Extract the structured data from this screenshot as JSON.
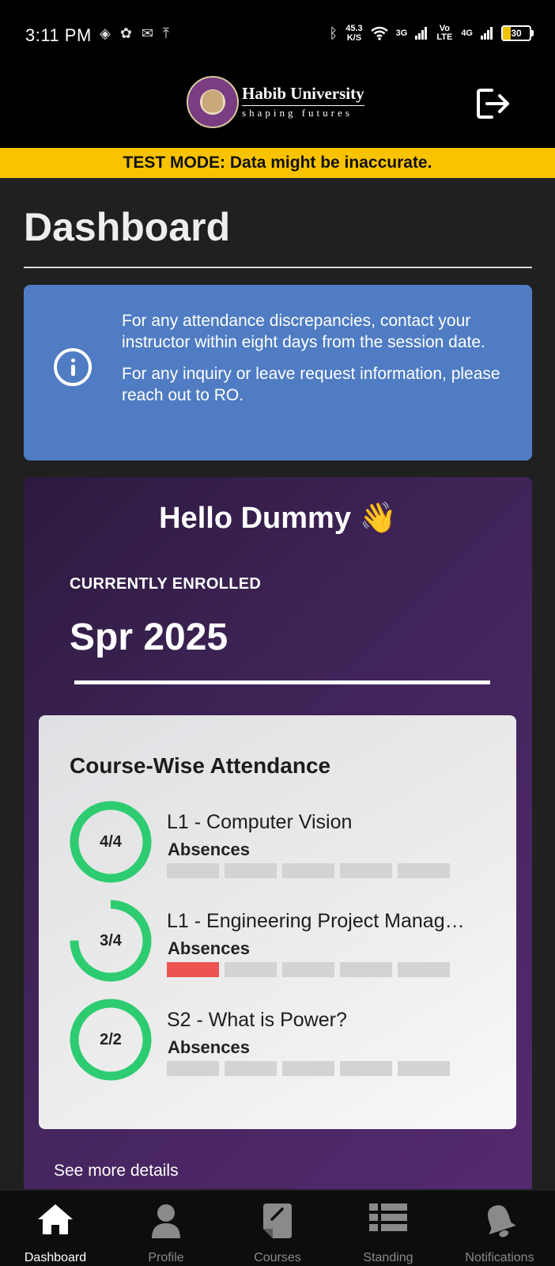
{
  "status_bar": {
    "time": "3:11 PM",
    "speed_value": "45.3",
    "speed_unit": "K/S",
    "net1": "3G",
    "volte": "Vo LTE",
    "net2": "4G",
    "battery": "30"
  },
  "header": {
    "university_name": "Habib University",
    "tagline": "shaping futures"
  },
  "banner": {
    "text": "TEST MODE: Data might be inaccurate."
  },
  "page": {
    "title": "Dashboard"
  },
  "info_card": {
    "line1": "For any attendance discrepancies, contact your instructor within eight days from the session date.",
    "line2": "For any inquiry or leave request information, please reach out to RO."
  },
  "enrollment": {
    "greeting": "Hello Dummy",
    "wave_emoji": "👋",
    "current_label": "CURRENTLY ENROLLED",
    "term": "Spr 2025"
  },
  "attendance": {
    "title": "Course-Wise Attendance",
    "absences_label": "Absences",
    "courses": [
      {
        "name": "L1 - Computer Vision",
        "ratio": "4/4",
        "attended": 4,
        "total": 4,
        "absences": 0
      },
      {
        "name": "L1 - Engineering Project Manag…",
        "ratio": "3/4",
        "attended": 3,
        "total": 4,
        "absences": 1
      },
      {
        "name": "S2 - What is Power?",
        "ratio": "2/2",
        "attended": 2,
        "total": 2,
        "absences": 0
      }
    ],
    "max_absence_slots": 5
  },
  "see_more": "See more details",
  "tabs": [
    {
      "label": "Dashboard",
      "icon": "home-icon",
      "active": true
    },
    {
      "label": "Profile",
      "icon": "person-icon",
      "active": false
    },
    {
      "label": "Courses",
      "icon": "courses-icon",
      "active": false
    },
    {
      "label": "Standing",
      "icon": "list-icon",
      "active": false
    },
    {
      "label": "Notifications",
      "icon": "bell-icon",
      "active": false
    }
  ],
  "colors": {
    "ring": "#2ecc71",
    "absence": "#eb5451",
    "banner": "#fac300",
    "info": "#4f7cc2"
  }
}
